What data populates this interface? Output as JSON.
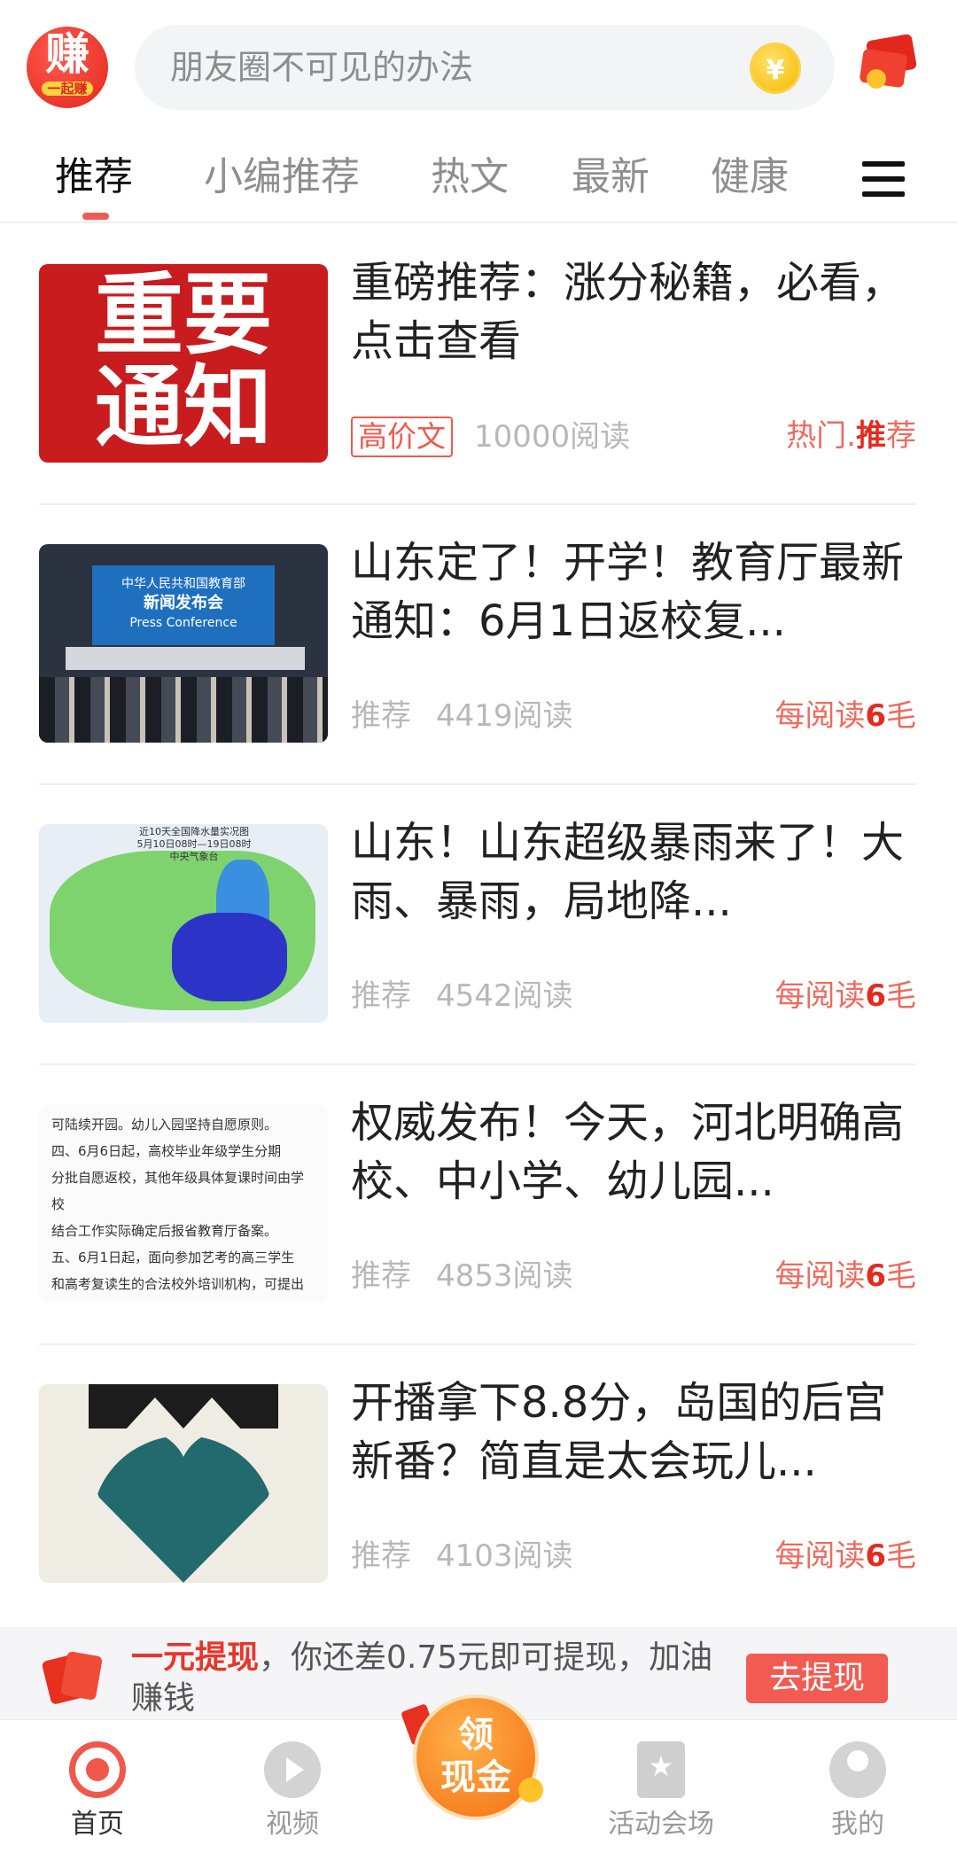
{
  "header": {
    "logo_main": "赚",
    "logo_sub": "一起赚",
    "search_placeholder": "朋友圈不可见的办法",
    "coin_symbol": "¥"
  },
  "tabs": [
    {
      "label": "推荐",
      "active": true
    },
    {
      "label": "小编推荐"
    },
    {
      "label": "热文"
    },
    {
      "label": "最新"
    },
    {
      "label": "健康"
    }
  ],
  "articles": [
    {
      "title": "重磅推荐：涨分秘籍，必看，点击查看",
      "badge": "高价文",
      "reads": "10000阅读",
      "reward_prefix": "热门.",
      "reward_strong": "推",
      "reward_suffix": "荐",
      "thumb_text": [
        "重要",
        "通知"
      ]
    },
    {
      "title": "山东定了！开学！教育厅最新通知：6月1日返校复...",
      "tag": "推荐",
      "reads": "4419阅读",
      "reward_prefix": "每阅读",
      "reward_strong": "6",
      "reward_suffix": "毛",
      "thumb_text": [
        "中华人民共和国教育部",
        "新闻发布会",
        "Press Conference"
      ]
    },
    {
      "title": "山东！山东超级暴雨来了！大雨、暴雨，局地降...",
      "tag": "推荐",
      "reads": "4542阅读",
      "reward_prefix": "每阅读",
      "reward_strong": "6",
      "reward_suffix": "毛",
      "thumb_text": [
        "近10天全国降水量实况图",
        "5月10日08时—19日08时",
        "中央气象台"
      ]
    },
    {
      "title": "权威发布！今天，河北明确高校、中小学、幼儿园...",
      "tag": "推荐",
      "reads": "4853阅读",
      "reward_prefix": "每阅读",
      "reward_strong": "6",
      "reward_suffix": "毛",
      "thumb_text": [
        "可陆续开园。幼儿入园坚持自愿原则。",
        "四、6月6日起，高校毕业年级学生分期",
        "分批自愿返校，其他年级具体复课时间由学校",
        "结合工作实际确定后报省教育厅备案。",
        "五、6月1日起，面向参加艺考的高三学生",
        "和高考复读生的合法校外培训机构，可提出线"
      ]
    },
    {
      "title": "开播拿下8.8分，岛国的后宫新番？简直是太会玩儿...",
      "tag": "推荐",
      "reads": "4103阅读",
      "reward_prefix": "每阅读",
      "reward_strong": "6",
      "reward_suffix": "毛"
    }
  ],
  "promo": {
    "strong": "一元提现",
    "text": "，你还差0.75元即可提现，加油赚钱",
    "button": "去提现"
  },
  "cash_button": {
    "line1": "领",
    "line2": "现金"
  },
  "nav": [
    {
      "label": "首页",
      "icon": "home-icon",
      "active": true
    },
    {
      "label": "视频",
      "icon": "video-play-icon"
    },
    {
      "label": "活动会场",
      "icon": "event-star-icon"
    },
    {
      "label": "我的",
      "icon": "profile-icon"
    }
  ],
  "colors": {
    "accent": "#f25b52",
    "reward_strong": "#e52b20",
    "tab_active": "#111111"
  }
}
